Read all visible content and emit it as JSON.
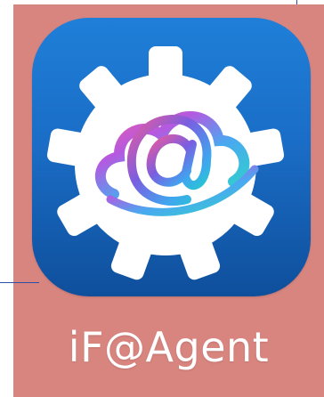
{
  "app": {
    "name": "iF@Agent",
    "icon": "gear-cloud-at-icon"
  },
  "colors": {
    "tile_background": "#d9857f",
    "icon_blue_top": "#1f7fd8",
    "icon_blue_bottom": "#0f4f9c",
    "gear_white": "#ffffff",
    "accent_line": "#2d4fa3"
  }
}
